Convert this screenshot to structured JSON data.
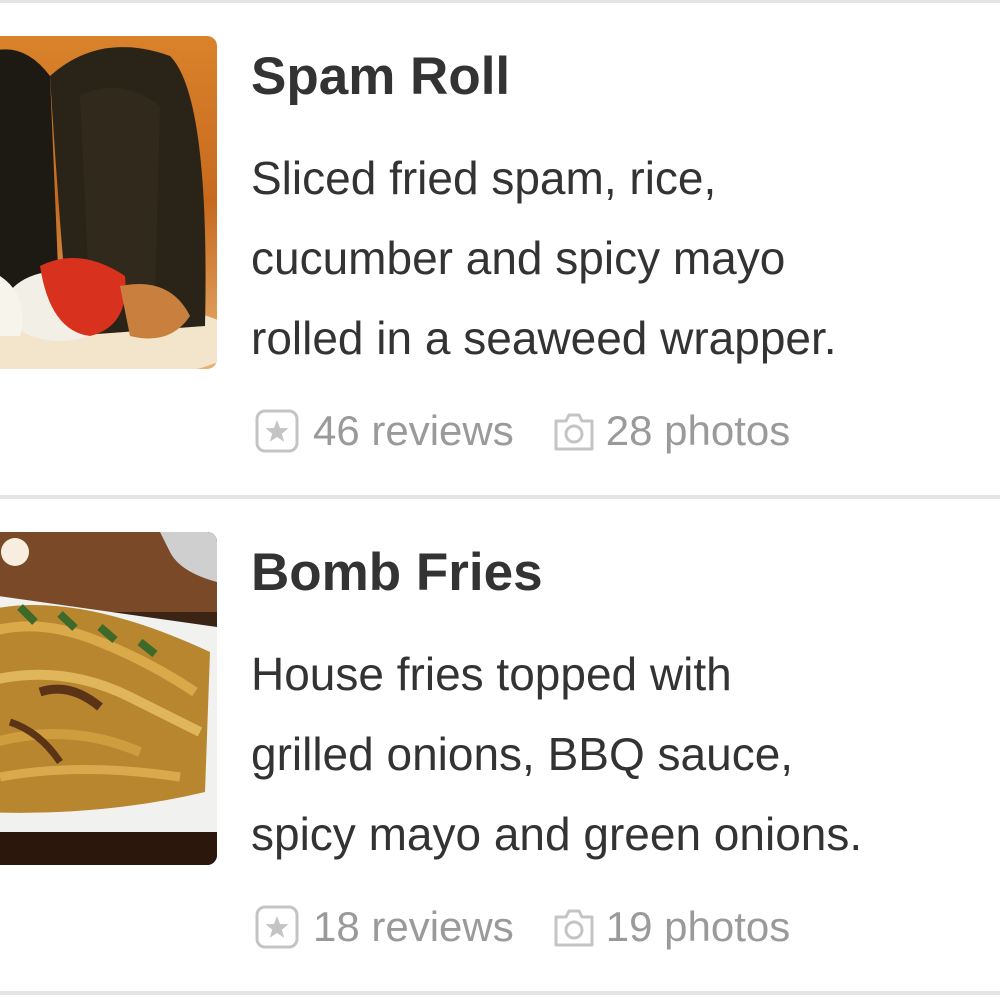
{
  "items": [
    {
      "title": "Spam Roll",
      "description_lines": [
        "Sliced fried spam, rice,",
        "cucumber and spicy mayo",
        "rolled in a seaweed wrapper."
      ],
      "reviews": "46 reviews",
      "photos": "28 photos",
      "thumbnail": "spam-roll-photo"
    },
    {
      "title": "Bomb Fries",
      "description_lines": [
        "House fries topped with",
        "grilled onions, BBQ sauce,",
        "spicy mayo and green onions."
      ],
      "reviews": "18 reviews",
      "photos": "19 photos",
      "thumbnail": "bomb-fries-photo"
    }
  ],
  "icons": {
    "reviews": "star-icon",
    "photos": "camera-icon"
  },
  "colors": {
    "title": "#333333",
    "description": "#333333",
    "meta": "#9a9a9a",
    "divider": "#e4e4e4"
  }
}
